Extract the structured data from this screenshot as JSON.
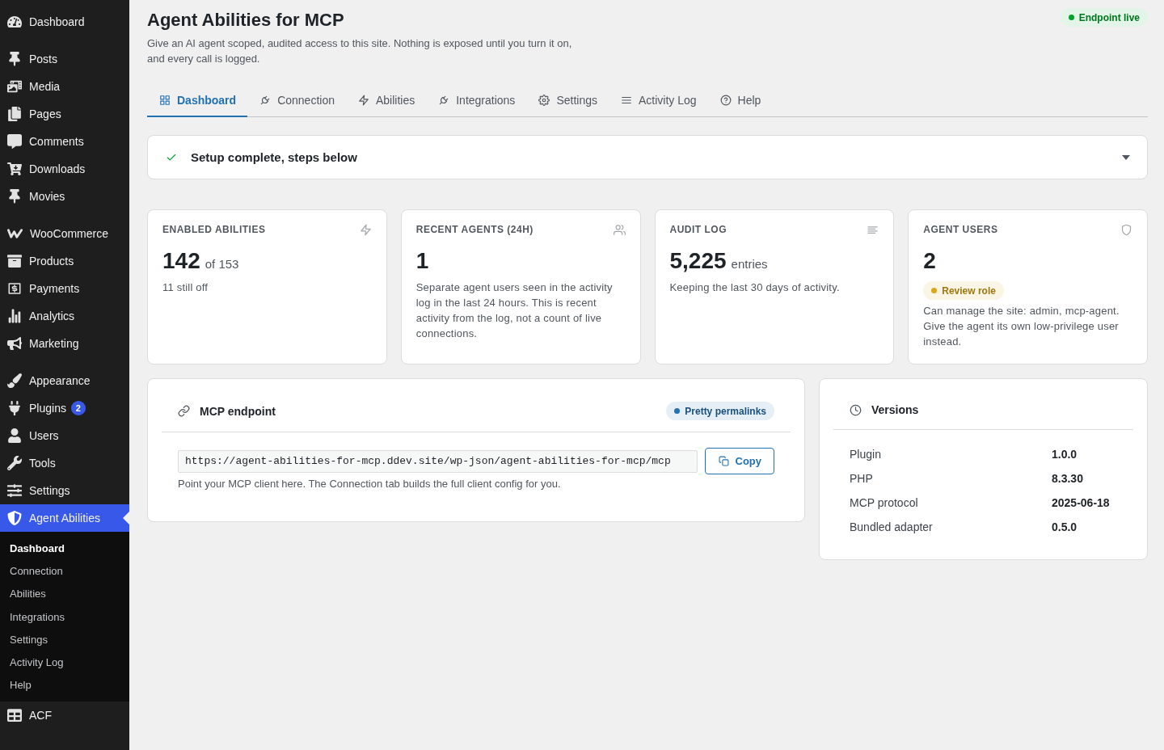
{
  "sidebar": {
    "menu_groups": [
      {
        "items": [
          {
            "label": "Dashboard",
            "selected": false
          }
        ]
      },
      {
        "items": [
          {
            "label": "Posts",
            "selected": false
          },
          {
            "label": "Media",
            "selected": false
          },
          {
            "label": "Pages",
            "selected": false
          },
          {
            "label": "Comments",
            "selected": false
          },
          {
            "label": "Downloads",
            "selected": false
          },
          {
            "label": "Movies",
            "selected": false
          }
        ]
      },
      {
        "items": [
          {
            "label": "WooCommerce",
            "selected": false
          },
          {
            "label": "Products",
            "selected": false
          },
          {
            "label": "Payments",
            "selected": false
          },
          {
            "label": "Analytics",
            "selected": false
          },
          {
            "label": "Marketing",
            "selected": false
          }
        ]
      },
      {
        "items": [
          {
            "label": "Appearance",
            "selected": false
          },
          {
            "label": "Plugins",
            "selected": false,
            "badge": "2"
          },
          {
            "label": "Users",
            "selected": false
          },
          {
            "label": "Tools",
            "selected": false
          },
          {
            "label": "Settings",
            "selected": false
          },
          {
            "label": "Agent Abilities",
            "selected": true,
            "children": [
              {
                "label": "Dashboard",
                "selected": true
              },
              {
                "label": "Connection",
                "selected": false
              },
              {
                "label": "Abilities",
                "selected": false
              },
              {
                "label": "Integrations",
                "selected": false
              },
              {
                "label": "Settings",
                "selected": false
              },
              {
                "label": "Activity Log",
                "selected": false
              },
              {
                "label": "Help",
                "selected": false
              }
            ]
          },
          {
            "label": "ACF",
            "selected": false
          }
        ]
      }
    ]
  },
  "header": {
    "title": "Agent Abilities for MCP",
    "description": "Give an AI agent scoped, audited access to this site. Nothing is exposed until you turn it on, and every call is logged.",
    "status_badge": {
      "label": "Endpoint live",
      "color": "#00a32a"
    }
  },
  "tabs": [
    {
      "label": "Dashboard",
      "selected": true
    },
    {
      "label": "Connection",
      "selected": false
    },
    {
      "label": "Abilities",
      "selected": false
    },
    {
      "label": "Integrations",
      "selected": false
    },
    {
      "label": "Settings",
      "selected": false
    },
    {
      "label": "Activity Log",
      "selected": false
    },
    {
      "label": "Help",
      "selected": false
    }
  ],
  "setup": {
    "title": "Setup complete, steps below",
    "complete": true,
    "expanded": false
  },
  "stats": [
    {
      "title": "ENABLED ABILITIES",
      "value": "142",
      "unit": "of 153",
      "note": "11 still off"
    },
    {
      "title": "RECENT AGENTS (24H)",
      "value": "1",
      "note": "Separate agent users seen in the activity log in the last 24 hours. This is recent activity from the log, not a count of live connections."
    },
    {
      "title": "AUDIT LOG",
      "value": "5,225",
      "unit": "entries",
      "note": "Keeping the last 30 days of activity."
    },
    {
      "title": "AGENT USERS",
      "value": "2",
      "badge": {
        "label": "Review role",
        "color": "#dba617"
      },
      "note": "Can manage the site: admin, mcp-agent. Give the agent its own low-privilege user instead."
    }
  ],
  "endpoint": {
    "title": "MCP endpoint",
    "badge": {
      "label": "Pretty permalinks",
      "color": "#2271b1"
    },
    "url": "https://agent-abilities-for-mcp.ddev.site/wp-json/agent-abilities-for-mcp/mcp",
    "copy_button": "Copy",
    "help": "Point your MCP client here. The Connection tab builds the full client config for you."
  },
  "versions": {
    "title": "Versions",
    "rows": [
      {
        "label": "Plugin",
        "value": "1.0.0"
      },
      {
        "label": "PHP",
        "value": "8.3.30"
      },
      {
        "label": "MCP protocol",
        "value": "2025-06-18"
      },
      {
        "label": "Bundled adapter",
        "value": "0.5.0"
      }
    ]
  }
}
